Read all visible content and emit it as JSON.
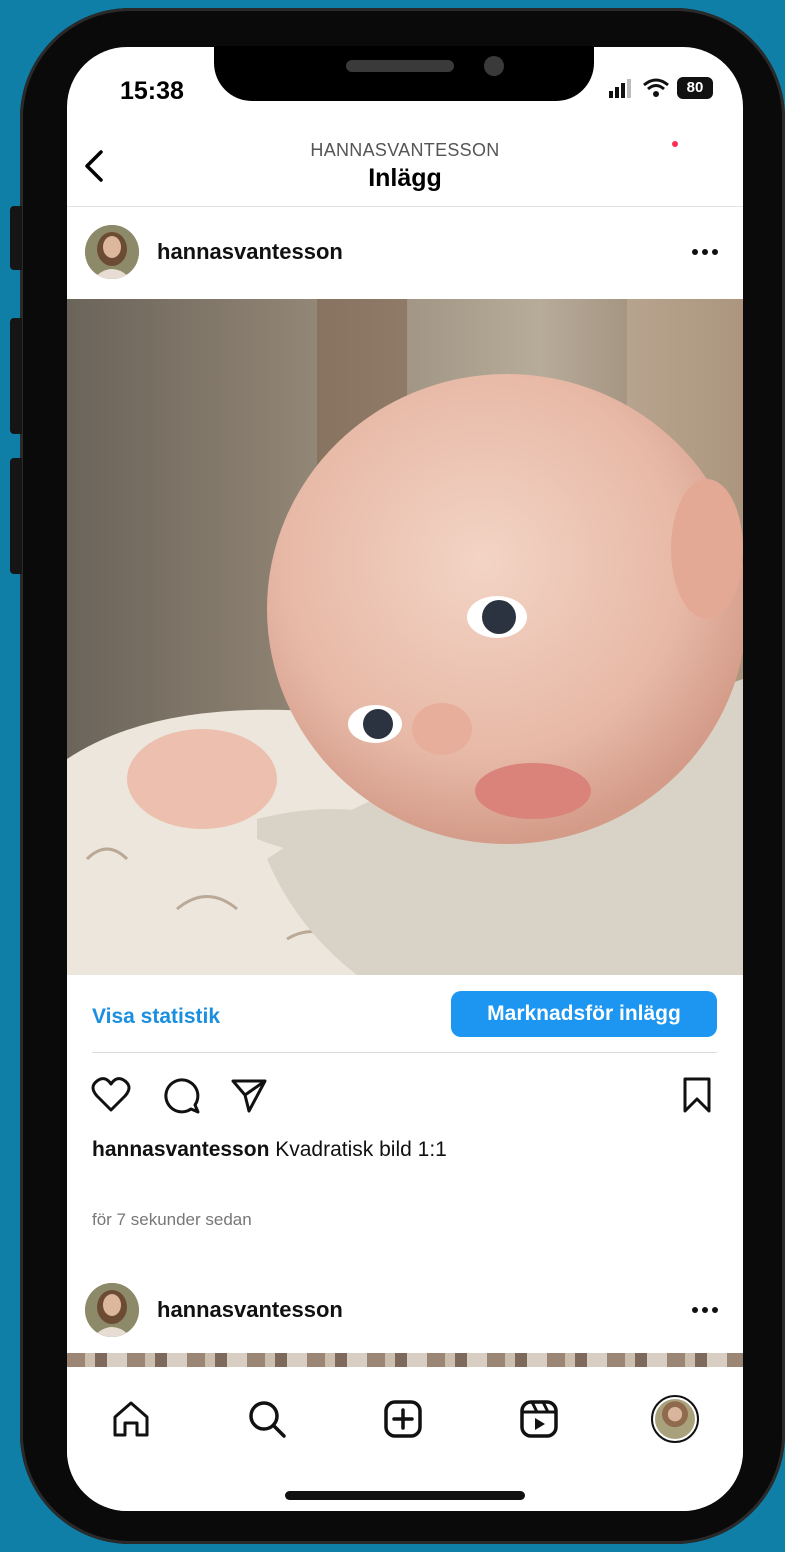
{
  "status_bar": {
    "time": "15:38",
    "battery": "80",
    "icons": [
      "signal-icon",
      "wifi-icon",
      "battery-icon"
    ]
  },
  "header": {
    "account": "HANNASVANTESSON",
    "title": "Inlägg",
    "back_icon": "chevron-left-icon"
  },
  "post": {
    "username": "hannasvantesson",
    "more_icon": "ellipsis-icon",
    "image_alt": "baby-photo",
    "stats_link": "Visa statistik",
    "promote_button": "Marknadsför inlägg",
    "actions": [
      "heart-icon",
      "comment-icon",
      "share-icon",
      "bookmark-icon"
    ],
    "caption_user": "hannasvantesson",
    "caption_text": "Kvadratisk bild 1:1",
    "timestamp": "för 7 sekunder sedan"
  },
  "next_post": {
    "username": "hannasvantesson"
  },
  "tab_bar": {
    "tabs": [
      "home-icon",
      "search-icon",
      "create-icon",
      "reels-icon",
      "profile-avatar"
    ]
  },
  "colors": {
    "background": "#0f7fa8",
    "accent": "#1c96f0",
    "link": "#1a8fe0",
    "notification": "#ff2d55"
  }
}
